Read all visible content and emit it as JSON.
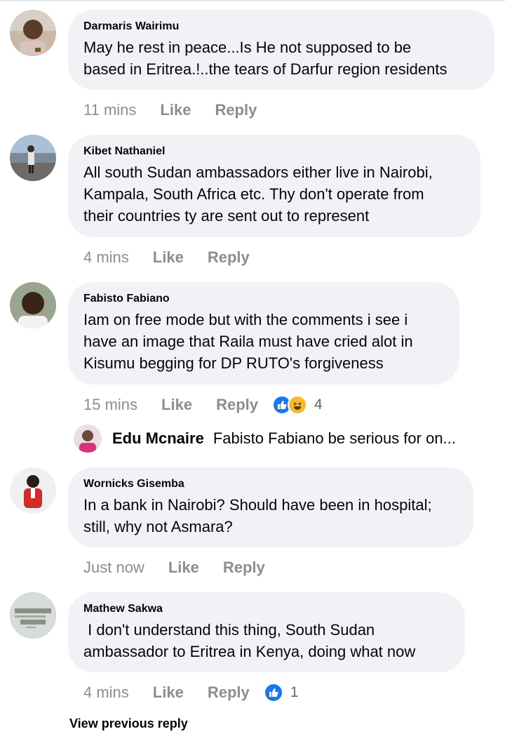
{
  "comments": [
    {
      "author": "Darmaris Wairimu",
      "lines": [
        "May he rest in peace...Is He not supposed to be",
        "based in Eritrea.!..the tears of Darfur region residents"
      ],
      "time": "11 mins",
      "like": "Like",
      "reply": "Reply",
      "avatar": "avatar-photo"
    },
    {
      "author": "Kibet Nathaniel",
      "lines": [
        "All south Sudan ambassadors either live in Nairobi,",
        "Kampala, South Africa etc. Thy don't operate from",
        "their countries ty are sent out to represent"
      ],
      "time": "4 mins",
      "like": "Like",
      "reply": "Reply",
      "avatar": "avatar-photo"
    },
    {
      "author": "Fabisto Fabiano",
      "lines": [
        "Iam on free mode but with the comments i see i",
        "have an image that Raila must have cried alot in",
        "Kisumu begging for DP RUTO's forgiveness"
      ],
      "time": "15 mins",
      "like": "Like",
      "reply": "Reply",
      "reactions": {
        "icons": [
          "like-reaction-icon",
          "haha-reaction-icon"
        ],
        "count": "4"
      },
      "avatar": "avatar-photo"
    },
    {
      "author": "Wornicks Gisemba",
      "lines": [
        "In a bank in Nairobi? Should have been in hospital;",
        "still, why not Asmara?"
      ],
      "time": "Just now",
      "like": "Like",
      "reply": "Reply",
      "avatar": "avatar-photo"
    },
    {
      "author": "Mathew Sakwa",
      "lines": [
        " I don't understand this thing, South Sudan",
        "ambassador to Eritrea in Kenya, doing what now"
      ],
      "time": "4 mins",
      "like": "Like",
      "reply": "Reply",
      "reactions": {
        "icons": [
          "like-reaction-icon"
        ],
        "count": "1"
      },
      "avatar": "avatar-photo"
    }
  ],
  "reply_preview": {
    "author": "Edu Mcnaire",
    "text": "Fabisto Fabiano be serious for on..."
  },
  "view_previous_reply": "View previous reply",
  "colors": {
    "bubble": "#f0f2f5",
    "text": "#050505",
    "meta": "#8a8d91",
    "like_blue": "#1877f2",
    "haha_yellow": "#f7b928"
  }
}
